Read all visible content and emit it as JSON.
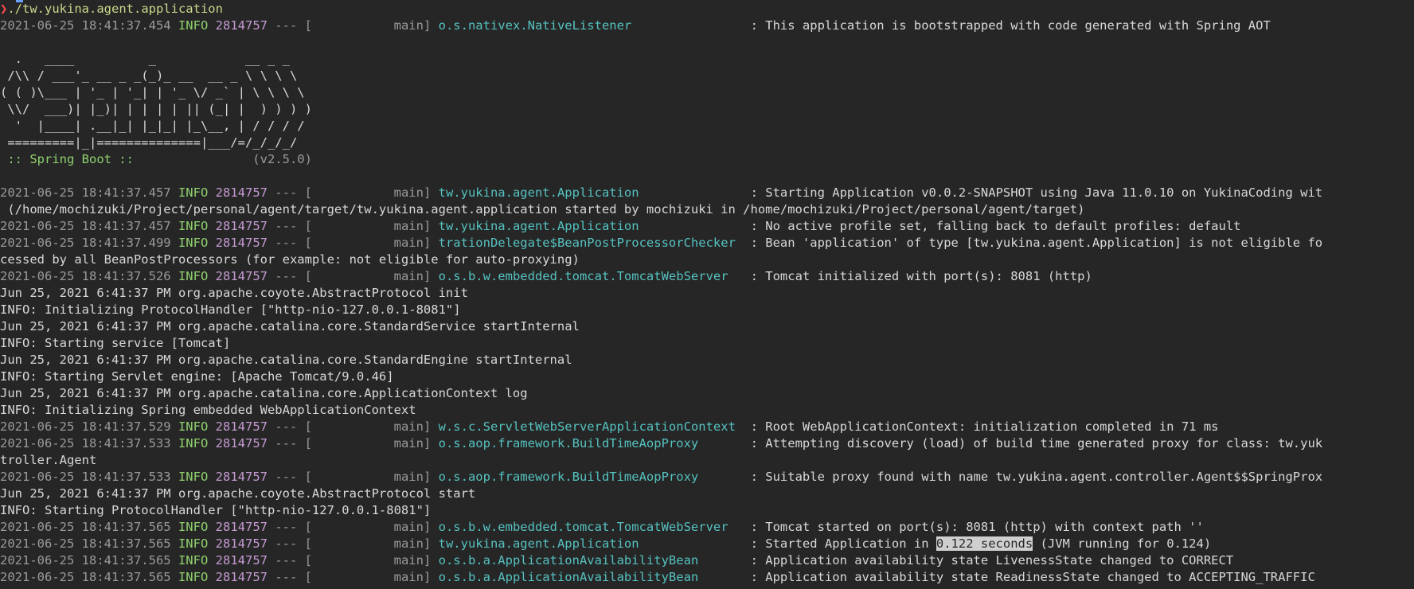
{
  "prompt": {
    "symbol": "❯",
    "command": "./tw.yukina.agent.application"
  },
  "banner": {
    "lines": [
      "  .   ____          _            __ _ _",
      " /\\\\ / ___'_ __ _ _(_)_ __  __ _ \\ \\ \\ \\",
      "( ( )\\___ | '_ | '_| | '_ \\/ _` | \\ \\ \\ \\",
      " \\\\/  ___)| |_)| | | | | || (_| |  ) ) ) )",
      "  '  |____| .__|_| |_|_| |_\\__, | / / / /",
      " =========|_|==============|___/=/_/_/_/"
    ],
    "spring_label": " :: Spring Boot :: ",
    "spring_version": "               (v2.5.0)"
  },
  "lines": [
    {
      "type": "log",
      "ts": "2021-06-25 18:41:37.454",
      "level": " INFO",
      "pid": "2814757",
      "sep": " --- [",
      "thread": "           main]",
      "logger": "o.s.nativex.NativeListener               ",
      "msg": " : This application is bootstrapped with code generated with Spring AOT"
    },
    {
      "type": "log",
      "ts": "2021-06-25 18:41:37.457",
      "level": " INFO",
      "pid": "2814757",
      "sep": " --- [",
      "thread": "           main]",
      "logger": "tw.yukina.agent.Application              ",
      "msg": " : Starting Application v0.0.2-SNAPSHOT using Java 11.0.10 on YukinaCoding wit"
    },
    {
      "type": "plain",
      "text": " (/home/mochizuki/Project/personal/agent/target/tw.yukina.agent.application started by mochizuki in /home/mochizuki/Project/personal/agent/target)"
    },
    {
      "type": "log",
      "ts": "2021-06-25 18:41:37.457",
      "level": " INFO",
      "pid": "2814757",
      "sep": " --- [",
      "thread": "           main]",
      "logger": "tw.yukina.agent.Application              ",
      "msg": " : No active profile set, falling back to default profiles: default"
    },
    {
      "type": "log",
      "ts": "2021-06-25 18:41:37.499",
      "level": " INFO",
      "pid": "2814757",
      "sep": " --- [",
      "thread": "           main]",
      "logger": "trationDelegate$BeanPostProcessorChecker ",
      "msg": " : Bean 'application' of type [tw.yukina.agent.Application] is not eligible fo"
    },
    {
      "type": "plain",
      "text": "cessed by all BeanPostProcessors (for example: not eligible for auto-proxying)"
    },
    {
      "type": "log",
      "ts": "2021-06-25 18:41:37.526",
      "level": " INFO",
      "pid": "2814757",
      "sep": " --- [",
      "thread": "           main]",
      "logger": "o.s.b.w.embedded.tomcat.TomcatWebServer  ",
      "msg": " : Tomcat initialized with port(s): 8081 (http)"
    },
    {
      "type": "plain",
      "text": "Jun 25, 2021 6:41:37 PM org.apache.coyote.AbstractProtocol init"
    },
    {
      "type": "plain",
      "text": "INFO: Initializing ProtocolHandler [\"http-nio-127.0.0.1-8081\"]"
    },
    {
      "type": "plain",
      "text": "Jun 25, 2021 6:41:37 PM org.apache.catalina.core.StandardService startInternal"
    },
    {
      "type": "plain",
      "text": "INFO: Starting service [Tomcat]"
    },
    {
      "type": "plain",
      "text": "Jun 25, 2021 6:41:37 PM org.apache.catalina.core.StandardEngine startInternal"
    },
    {
      "type": "plain",
      "text": "INFO: Starting Servlet engine: [Apache Tomcat/9.0.46]"
    },
    {
      "type": "plain",
      "text": "Jun 25, 2021 6:41:37 PM org.apache.catalina.core.ApplicationContext log"
    },
    {
      "type": "plain",
      "text": "INFO: Initializing Spring embedded WebApplicationContext"
    },
    {
      "type": "log",
      "ts": "2021-06-25 18:41:37.529",
      "level": " INFO",
      "pid": "2814757",
      "sep": " --- [",
      "thread": "           main]",
      "logger": "w.s.c.ServletWebServerApplicationContext ",
      "msg": " : Root WebApplicationContext: initialization completed in 71 ms"
    },
    {
      "type": "log",
      "ts": "2021-06-25 18:41:37.533",
      "level": " INFO",
      "pid": "2814757",
      "sep": " --- [",
      "thread": "           main]",
      "logger": "o.s.aop.framework.BuildTimeAopProxy      ",
      "msg": " : Attempting discovery (load) of build time generated proxy for class: tw.yuk"
    },
    {
      "type": "plain",
      "text": "troller.Agent"
    },
    {
      "type": "log",
      "ts": "2021-06-25 18:41:37.533",
      "level": " INFO",
      "pid": "2814757",
      "sep": " --- [",
      "thread": "           main]",
      "logger": "o.s.aop.framework.BuildTimeAopProxy      ",
      "msg": " : Suitable proxy found with name tw.yukina.agent.controller.Agent$$SpringProx"
    },
    {
      "type": "plain",
      "text": "Jun 25, 2021 6:41:37 PM org.apache.coyote.AbstractProtocol start"
    },
    {
      "type": "plain",
      "text": "INFO: Starting ProtocolHandler [\"http-nio-127.0.0.1-8081\"]"
    },
    {
      "type": "log",
      "ts": "2021-06-25 18:41:37.565",
      "level": " INFO",
      "pid": "2814757",
      "sep": " --- [",
      "thread": "           main]",
      "logger": "o.s.b.w.embedded.tomcat.TomcatWebServer  ",
      "msg": " : Tomcat started on port(s): 8081 (http) with context path ''"
    },
    {
      "type": "log",
      "ts": "2021-06-25 18:41:37.565",
      "level": " INFO",
      "pid": "2814757",
      "sep": " --- [",
      "thread": "           main]",
      "logger": "tw.yukina.agent.Application              ",
      "msg": " : Started Application in ",
      "hl": "0.122 seconds",
      "msg2": " (JVM running for 0.124)"
    },
    {
      "type": "log",
      "ts": "2021-06-25 18:41:37.565",
      "level": " INFO",
      "pid": "2814757",
      "sep": " --- [",
      "thread": "           main]",
      "logger": "o.s.b.a.ApplicationAvailabilityBean      ",
      "msg": " : Application availability state LivenessState changed to CORRECT"
    },
    {
      "type": "log",
      "ts": "2021-06-25 18:41:37.565",
      "level": " INFO",
      "pid": "2814757",
      "sep": " --- [",
      "thread": "           main]",
      "logger": "o.s.b.a.ApplicationAvailabilityBean      ",
      "msg": " : Application availability state ReadinessState changed to ACCEPTING_TRAFFIC"
    }
  ]
}
